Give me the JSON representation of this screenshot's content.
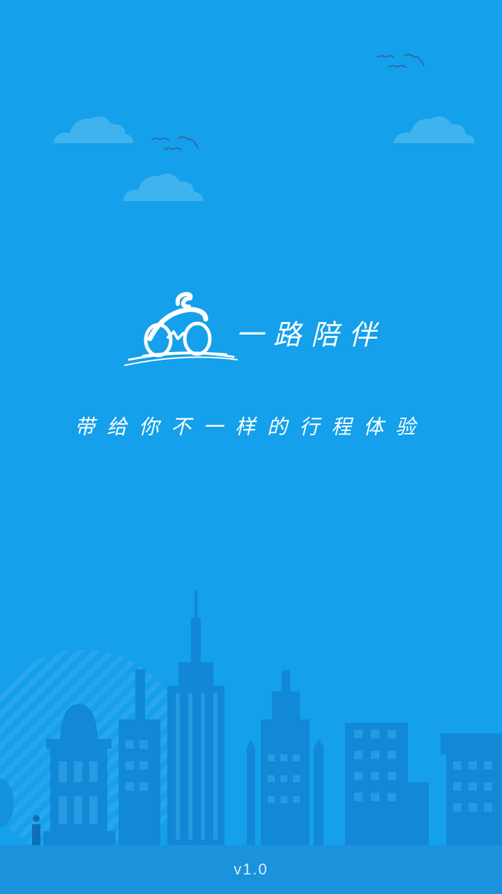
{
  "app": {
    "name": "一路陪伴",
    "slogan": "带给你不一样的行程体验",
    "version": "v1.0"
  },
  "colors": {
    "background": "#14a0ea",
    "cloud": "#3fb3ee",
    "building": "#1289d6",
    "ground": "#1a92dc",
    "text": "#ffffff"
  },
  "icons": [
    "cloud-icon",
    "bird-icon",
    "bicycle-rider-logo-icon",
    "city-skyline-illustration"
  ]
}
